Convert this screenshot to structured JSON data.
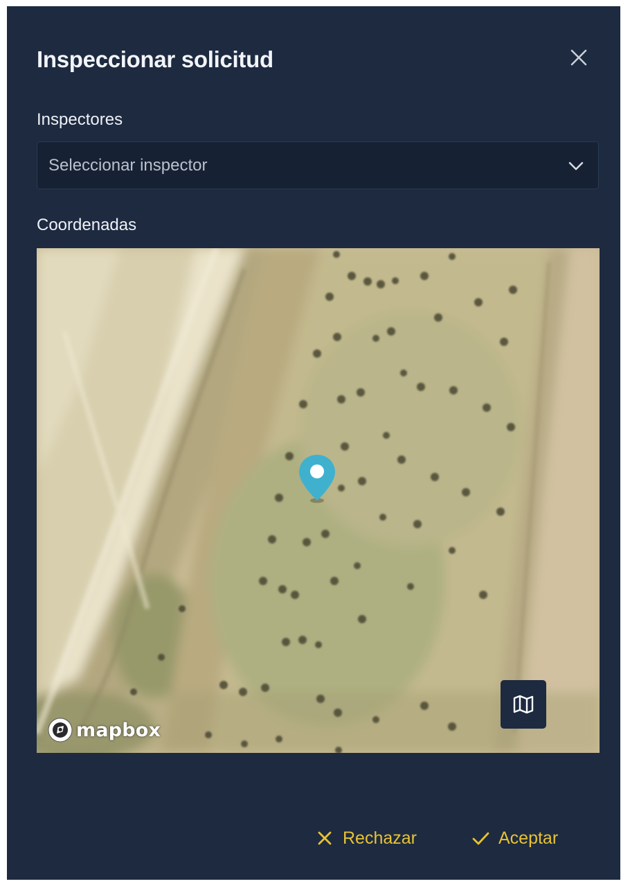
{
  "dialog": {
    "title": "Inspeccionar solicitud",
    "close_icon": "close-icon"
  },
  "inspectors": {
    "label": "Inspectores",
    "placeholder": "Seleccionar inspector",
    "chevron_icon": "chevron-down-icon"
  },
  "coordinates": {
    "label": "Coordenadas",
    "map": {
      "attribution": "mapbox",
      "marker_icon": "map-pin-icon",
      "style_toggle_icon": "map-icon",
      "imagery": "satellite"
    }
  },
  "actions": {
    "reject_label": "Rechazar",
    "reject_icon": "x-icon",
    "accept_label": "Aceptar",
    "accept_icon": "check-icon"
  },
  "colors": {
    "panel_bg": "#1d2a40",
    "input_bg": "#162133",
    "accent": "#e8c233",
    "marker": "#3fb1ce"
  }
}
